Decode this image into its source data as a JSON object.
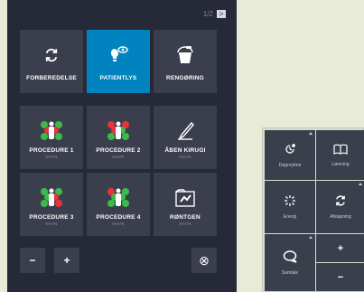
{
  "pager": {
    "text": "1/2",
    "next_icon": ">"
  },
  "row1": [
    {
      "label": "FORBEREDELSE",
      "icon": "refresh-icon"
    },
    {
      "label": "PATIENTLYS",
      "icon": "bulb-eye-icon",
      "active": true
    },
    {
      "label": "RENGØRING",
      "icon": "bucket-icon"
    }
  ],
  "grid": [
    {
      "label": "PROCEDURE 1",
      "sub": "NAVN",
      "icon": "procedure-icon"
    },
    {
      "label": "PROCEDURE 2",
      "sub": "NAVN",
      "icon": "procedure-icon"
    },
    {
      "label": "ÅBEN KIRUGI",
      "sub": "NAVN",
      "icon": "scalpel-icon"
    },
    {
      "label": "PROCEDURE 3",
      "sub": "NAVN",
      "icon": "procedure-icon"
    },
    {
      "label": "PROCEDURE 4",
      "sub": "NAVN",
      "icon": "procedure-icon"
    },
    {
      "label": "RØNTGEN",
      "sub": "NAVN",
      "icon": "xray-icon"
    }
  ],
  "controls": {
    "minus": "−",
    "plus": "+",
    "close": "⊗"
  },
  "widget": {
    "cells": [
      {
        "label": "Døgnrytme",
        "icon": "circadian-icon"
      },
      {
        "label": "Læsning",
        "icon": "book-icon"
      },
      {
        "label": "Energi",
        "icon": "sparkle-icon"
      },
      {
        "label": "Afslapning",
        "icon": "relax-icon"
      },
      {
        "label": "Samtale",
        "icon": "chat-icon"
      }
    ],
    "plus": "+",
    "minus": "−"
  },
  "colors": {
    "panel": "#262a38",
    "tile": "#3b3f4d",
    "active": "#0083bf",
    "red": "#e8323c",
    "green": "#3dbb4a"
  }
}
